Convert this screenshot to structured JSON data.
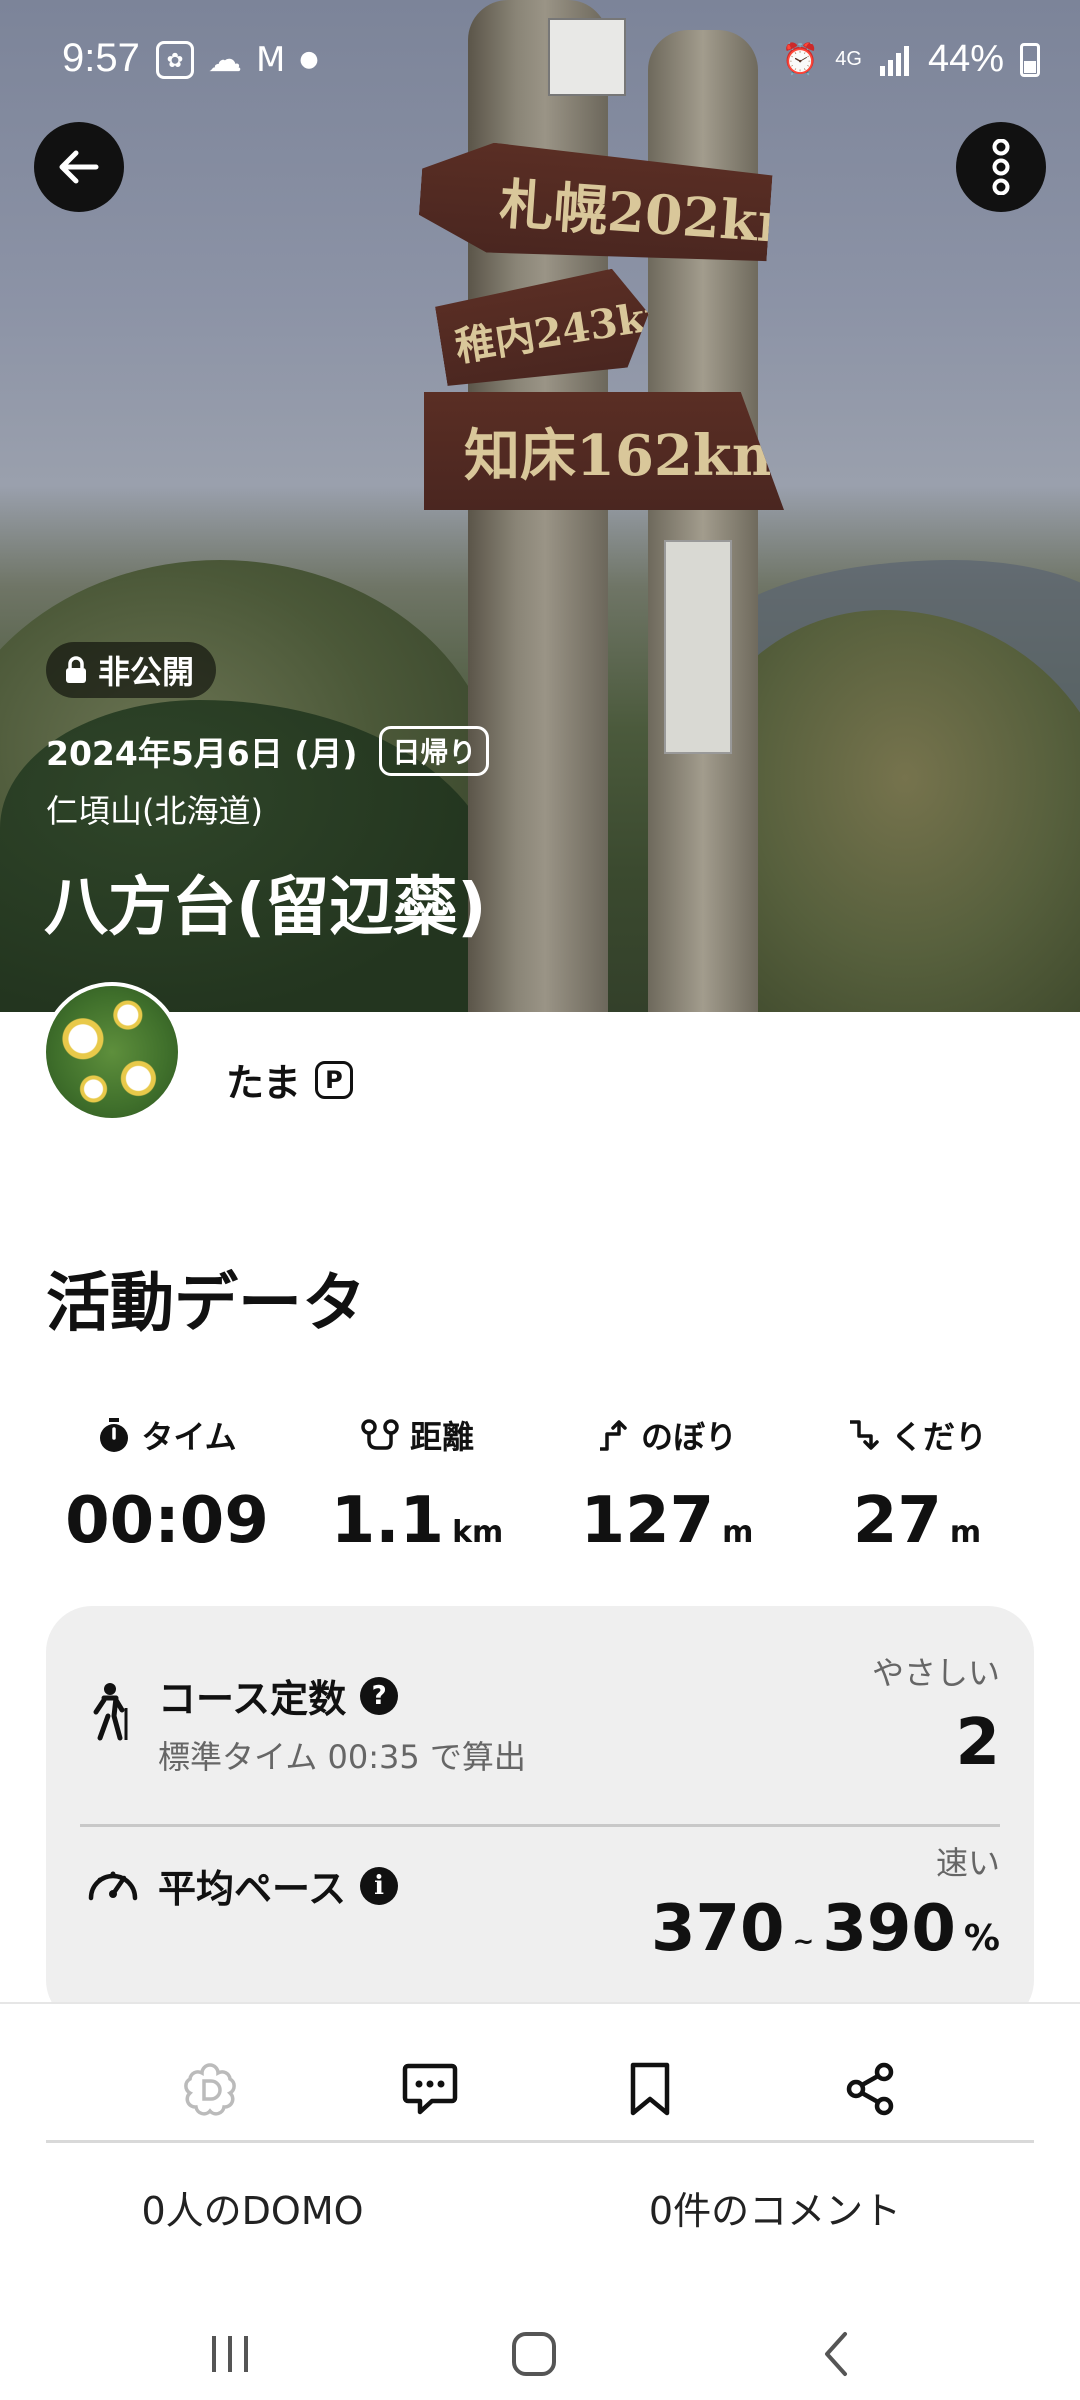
{
  "status_bar": {
    "time": "9:57",
    "notification_icons": [
      "app-icon",
      "cloud-icon",
      "gmail-icon",
      "dot-icon"
    ],
    "right_icons": [
      "alarm-icon",
      "4g-icon",
      "signal-icon"
    ],
    "network": "4G",
    "battery": "44%"
  },
  "hero": {
    "signs": [
      "札幌202km",
      "稚内243km",
      "知床162km"
    ],
    "visibility_badge": "非公開",
    "date": "2024年5月6日 (月)",
    "trip_type": "日帰り",
    "area": "仁頃山(北海道)",
    "title": "八方台(留辺蘂)"
  },
  "user": {
    "name": "たま",
    "badge": "P"
  },
  "activity": {
    "section_title": "活動データ",
    "stats": [
      {
        "label": "タイム",
        "value": "00:09",
        "unit": "",
        "icon": "stopwatch-icon"
      },
      {
        "label": "距離",
        "value": "1.1",
        "unit": "km",
        "icon": "route-icon"
      },
      {
        "label": "のぼり",
        "value": "127",
        "unit": "m",
        "icon": "ascent-icon"
      },
      {
        "label": "くだり",
        "value": "27",
        "unit": "m",
        "icon": "descent-icon"
      }
    ]
  },
  "course": {
    "title": "コース定数",
    "subtitle": "標準タイム 00:35 で算出",
    "rating_label": "やさしい",
    "value": "2"
  },
  "pace": {
    "title": "平均ペース",
    "rating_label": "速い",
    "min": "370",
    "tilde": "~",
    "max": "390",
    "unit": "%"
  },
  "actions": {
    "domo_count": "0人のDOMO",
    "comment_count": "0件のコメント"
  },
  "colors": {
    "accent_dark": "#111111",
    "card_bg": "#efefef",
    "muted_text": "#666666"
  }
}
